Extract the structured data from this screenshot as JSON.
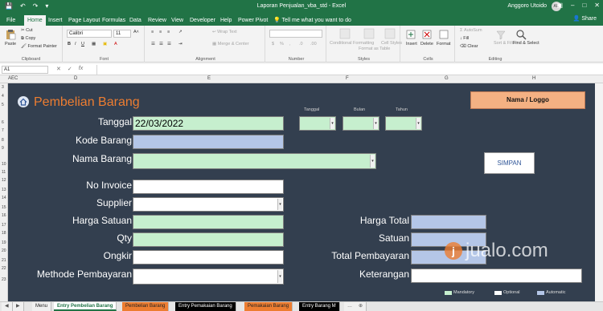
{
  "app": {
    "window_title": "Laporan Penjualan_vba_std  -  Excel",
    "user_name": "Anggoro Utoido",
    "user_initials": "AU",
    "share_label": "Share",
    "tell_me": "Tell me what you want to do"
  },
  "ribbon_tabs": [
    "File",
    "Home",
    "Insert",
    "Page Layout",
    "Formulas",
    "Data",
    "Review",
    "View",
    "Developer",
    "Help",
    "Power Pivot"
  ],
  "active_tab": "Home",
  "ribbon": {
    "clipboard": {
      "label": "Clipboard",
      "paste": "Paste",
      "cut": "Cut",
      "copy": "Copy",
      "format_painter": "Format Painter"
    },
    "font": {
      "label": "Font",
      "name": "Calibri",
      "size": "11"
    },
    "alignment": {
      "label": "Alignment",
      "wrap_text": "Wrap Text",
      "merge_center": "Merge & Center"
    },
    "number": {
      "label": "Number"
    },
    "styles": {
      "label": "Styles",
      "conditional": "Conditional Formatting",
      "format_table": "Format as Table",
      "cell_styles": "Cell Styles"
    },
    "cells": {
      "label": "Cells",
      "insert": "Insert",
      "delete": "Delete",
      "format": "Format"
    },
    "editing": {
      "label": "Editing",
      "autosum": "AutoSum",
      "fill": "Fill",
      "clear": "Clear",
      "sort_filter": "Sort & Filter",
      "find_select": "Find & Select"
    }
  },
  "formula_bar": {
    "name_box": "A1",
    "fx": "fx",
    "content": ""
  },
  "columns": [
    "AEC",
    "D",
    "E",
    "F",
    "G",
    "H"
  ],
  "rows": [
    "3",
    "4",
    "5",
    "6",
    "7",
    "8",
    "9",
    "10",
    "11",
    "12",
    "13",
    "14",
    "15",
    "16",
    "17",
    "18",
    "19",
    "20",
    "21",
    "22",
    "23"
  ],
  "form": {
    "title": "Pembelian Barang",
    "logo": "Nama / Loggo",
    "tanggal_label": "Tanggal",
    "tanggal_value": "22/03/2022",
    "tanggal_small": "Tanggal",
    "bulan_small": "Bulan",
    "tahun_small": "Tahun",
    "kode_barang": "Kode Barang",
    "nama_barang": "Nama Barang",
    "no_invoice": "No Invoice",
    "supplier": "Supplier",
    "harga_satuan": "Harga Satuan",
    "qty": "Qty",
    "ongkir": "Ongkir",
    "metode": "Methode Pembayaran",
    "harga_total": "Harga Total",
    "satuan": "Satuan",
    "total_pembayaran": "Total Pembayaran",
    "keterangan": "Keterangan",
    "simpan": "SIMPAN",
    "legend_mandatory": "Mandatory",
    "legend_optional": "Optional",
    "legend_automatic": "Automatic"
  },
  "watermark": "jualo.com",
  "sheet_tabs": [
    "Menu",
    "Entry Pembelian Barang",
    "Pembelian Barang",
    "Entry Pemakaian Barang",
    "Pemakaian Barang",
    "Entry Barang M"
  ],
  "colors": {
    "excel_green": "#217346",
    "panel": "#333f4f",
    "mandatory": "#c6efce",
    "automatic": "#b4c6e7",
    "title_orange": "#ed7d31",
    "logo_box": "#f4b183"
  }
}
